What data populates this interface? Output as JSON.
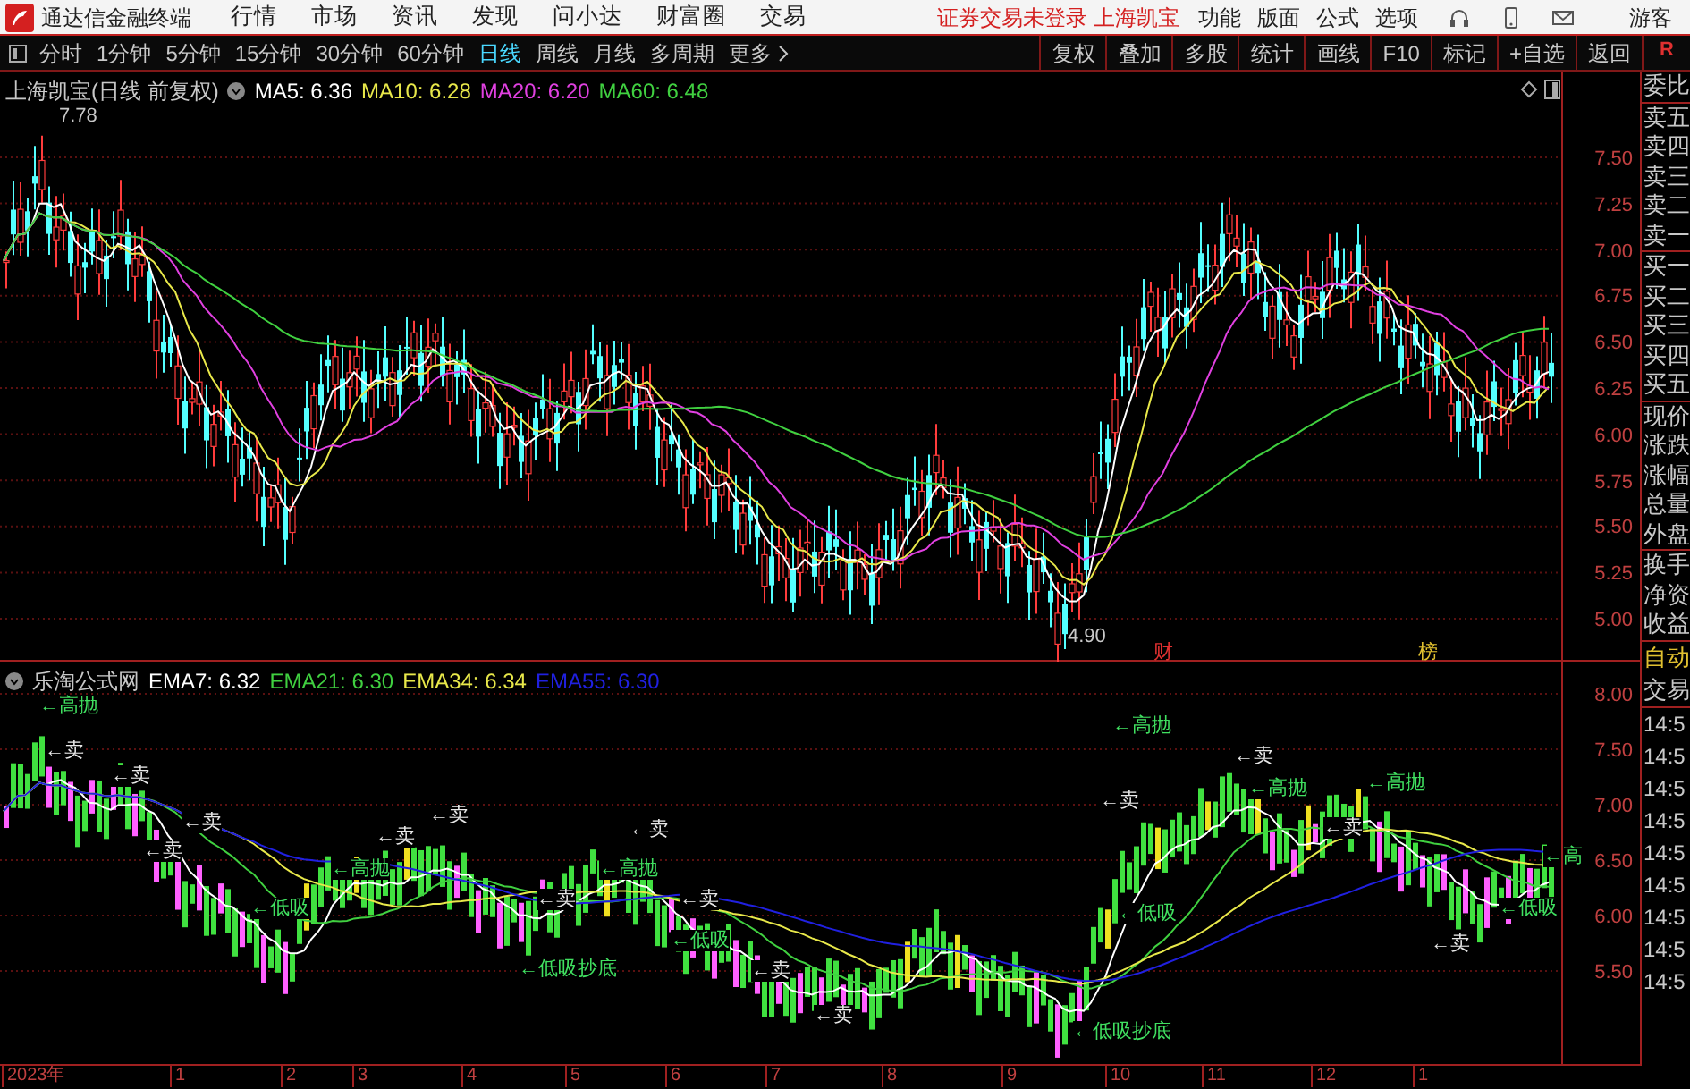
{
  "app": {
    "title": "通达信金融终端"
  },
  "menu": [
    "行情",
    "市场",
    "资讯",
    "发现",
    "问小达",
    "财富圈",
    "交易"
  ],
  "notice": "证券交易未登录 上海凯宝",
  "right_menu": [
    "功能",
    "版面",
    "公式",
    "选项"
  ],
  "user": "游客",
  "periods": [
    {
      "label": "分时",
      "selected": false
    },
    {
      "label": "1分钟",
      "selected": false
    },
    {
      "label": "5分钟",
      "selected": false
    },
    {
      "label": "15分钟",
      "selected": false
    },
    {
      "label": "30分钟",
      "selected": false
    },
    {
      "label": "60分钟",
      "selected": false
    },
    {
      "label": "日线",
      "selected": true
    },
    {
      "label": "周线",
      "selected": false
    },
    {
      "label": "月线",
      "selected": false
    },
    {
      "label": "多周期",
      "selected": false
    },
    {
      "label": "更多",
      "selected": false
    }
  ],
  "tools": [
    "复权",
    "叠加",
    "多股",
    "统计",
    "画线",
    "F10",
    "标记",
    "+自选",
    "返回"
  ],
  "corner": "R",
  "main_chart": {
    "title": "上海凯宝(日线 前复权)",
    "indicators": [
      {
        "name": "MA5: 6.36",
        "color": "#ffffff"
      },
      {
        "name": "MA10: 6.28",
        "color": "#e8e84a"
      },
      {
        "name": "MA20: 6.20",
        "color": "#e040e0"
      },
      {
        "name": "MA60: 6.48",
        "color": "#40d040"
      }
    ],
    "high_label": "7.78",
    "low_label": "4.90",
    "markers": [
      {
        "text": "财",
        "color": "#e03030"
      },
      {
        "text": "榜",
        "color": "#e0c030"
      }
    ],
    "price_ticks": [
      "7.50",
      "7.25",
      "7.00",
      "6.75",
      "6.50",
      "6.25",
      "6.00",
      "5.75",
      "5.50",
      "5.25",
      "5.00"
    ]
  },
  "sub_chart": {
    "title": "乐淘公式网",
    "indicators": [
      {
        "name": "EMA7: 6.32",
        "color": "#ffffff"
      },
      {
        "name": "EMA21: 6.30",
        "color": "#40d040"
      },
      {
        "name": "EMA34: 6.34",
        "color": "#e8e84a"
      },
      {
        "name": "EMA55: 6.30",
        "color": "#2020e0"
      }
    ],
    "signals": [
      {
        "text": "←高抛",
        "kind": "high"
      },
      {
        "text": "←卖",
        "kind": "sell"
      },
      {
        "text": "←卖",
        "kind": "sell"
      },
      {
        "text": "←卖",
        "kind": "sell"
      },
      {
        "text": "←卖",
        "kind": "sell"
      },
      {
        "text": "←高抛",
        "kind": "high"
      },
      {
        "text": "←低吸",
        "kind": "low"
      },
      {
        "text": "←卖",
        "kind": "sell"
      },
      {
        "text": "←卖",
        "kind": "sell"
      },
      {
        "text": "←卖",
        "kind": "sell"
      },
      {
        "text": "←高抛",
        "kind": "high"
      },
      {
        "text": "←低吸抄底",
        "kind": "low"
      },
      {
        "text": "←卖",
        "kind": "sell"
      },
      {
        "text": "←卖",
        "kind": "sell"
      },
      {
        "text": "←卖",
        "kind": "sell"
      },
      {
        "text": "←低吸",
        "kind": "low"
      },
      {
        "text": "←卖",
        "kind": "sell"
      },
      {
        "text": "←高抛",
        "kind": "high"
      },
      {
        "text": "←卖",
        "kind": "sell"
      },
      {
        "text": "←低吸",
        "kind": "low"
      },
      {
        "text": "←低吸抄底",
        "kind": "low"
      },
      {
        "text": "←卖",
        "kind": "sell"
      },
      {
        "text": "←高抛",
        "kind": "high"
      },
      {
        "text": "←卖",
        "kind": "sell"
      },
      {
        "text": "←高抛",
        "kind": "high"
      },
      {
        "text": "←低吸",
        "kind": "low"
      },
      {
        "text": "←卖",
        "kind": "sell"
      },
      {
        "text": "←高",
        "kind": "high"
      }
    ],
    "price_ticks": [
      "8.00",
      "7.50",
      "7.00",
      "6.50",
      "6.00",
      "5.50"
    ]
  },
  "x_axis": [
    "2023年",
    "1",
    "2",
    "3",
    "4",
    "5",
    "6",
    "7",
    "8",
    "9",
    "10",
    "11",
    "12",
    "1"
  ],
  "quote_panel": {
    "labels": [
      "委比",
      "卖五",
      "卖四",
      "卖三",
      "卖二",
      "卖一",
      "买一",
      "买二",
      "买三",
      "买四",
      "买五",
      "现价",
      "涨跌",
      "涨幅",
      "总量",
      "外盘",
      "换手",
      "净资",
      "收益"
    ],
    "mode": "自动",
    "trade": "交易",
    "times": [
      "14:5",
      "14:5",
      "14:5",
      "14:5",
      "14:5",
      "14:5",
      "14:5",
      "14:5",
      "14:5"
    ]
  }
}
